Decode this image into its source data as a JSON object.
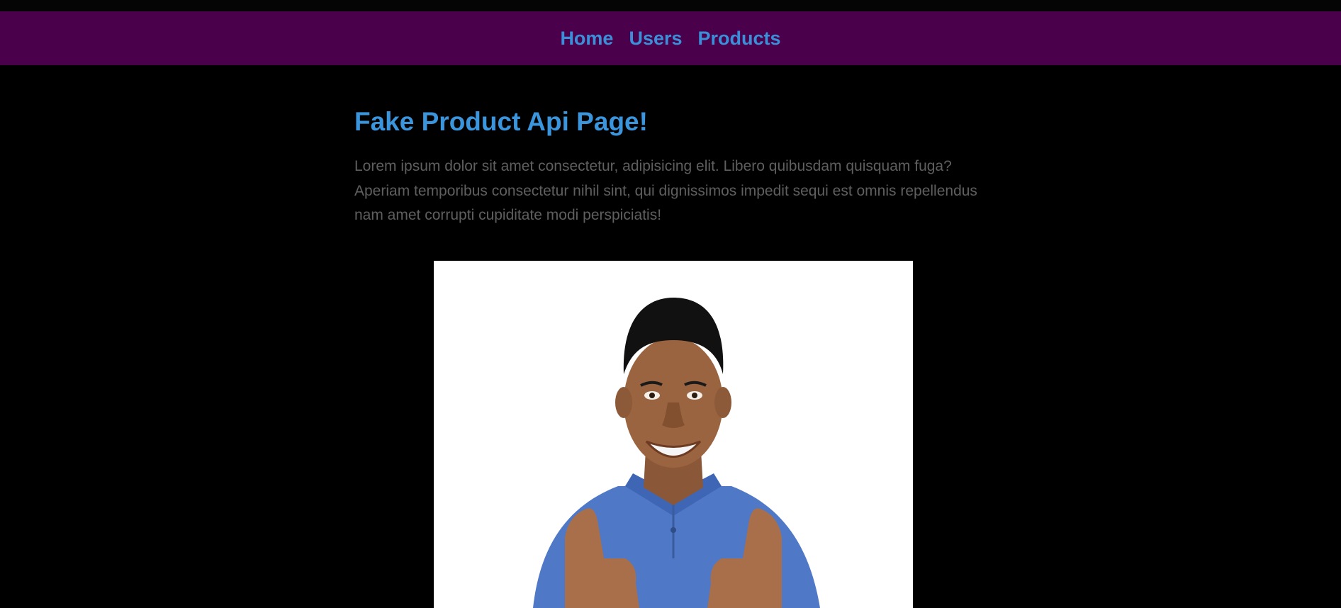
{
  "nav": {
    "links": [
      {
        "label": "Home"
      },
      {
        "label": "Users"
      },
      {
        "label": "Products"
      }
    ]
  },
  "main": {
    "title": "Fake Product Api Page!",
    "intro": "Lorem ipsum dolor sit amet consectetur, adipisicing elit. Libero quibusdam quisquam fuga? Aperiam temporibus consectetur nihil sint, qui dignissimos impedit sequi est omnis repellendus nam amet corrupti cupiditate modi perspiciatis!"
  },
  "colors": {
    "navbar_bg": "#4a004a",
    "link": "#3b8fd9",
    "title": "#3b95dc",
    "body_text": "#5f5f5f",
    "page_bg": "#000000"
  }
}
